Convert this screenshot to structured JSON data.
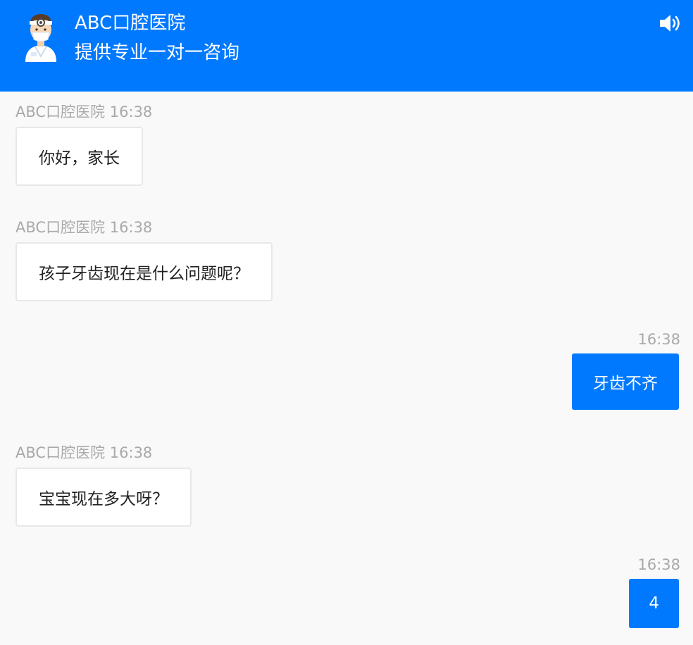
{
  "header": {
    "title": "ABC口腔医院",
    "subtitle": "提供专业一对一咨询",
    "avatar_icon": "doctor-avatar-icon",
    "sound_icon": "speaker-icon",
    "background_color": "#0079fe"
  },
  "messages": [
    {
      "sender": "ABC口腔医院",
      "time": "16:38",
      "text": "你好，家长",
      "direction": "incoming"
    },
    {
      "sender": "ABC口腔医院",
      "time": "16:38",
      "text": "孩子牙齿现在是什么问题呢？",
      "direction": "incoming"
    },
    {
      "sender": "",
      "time": "16:38",
      "text": "牙齿不齐",
      "direction": "outgoing"
    },
    {
      "sender": "ABC口腔医院",
      "time": "16:38",
      "text": "宝宝现在多大呀？",
      "direction": "incoming"
    },
    {
      "sender": "",
      "time": "16:38",
      "text": "4",
      "direction": "outgoing"
    }
  ]
}
